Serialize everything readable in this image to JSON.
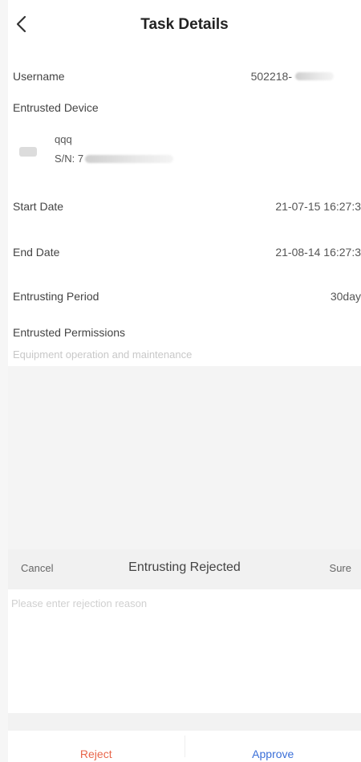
{
  "header": {
    "title": "Task Details",
    "back_icon": "chevron-left-icon"
  },
  "details": {
    "username_label": "Username",
    "username_value": "502218-",
    "device_label": "Entrusted Device",
    "device_icon": "device-icon",
    "device_name": "qqq",
    "device_sn": "S/N: 7",
    "start_label": "Start Date",
    "start_value": "21-07-15 16:27:3",
    "end_label": "End Date",
    "end_value": "21-08-14 16:27:3",
    "period_label": "Entrusting Period",
    "period_value": "30day",
    "permissions_label": "Entrusted Permissions",
    "permissions_value": "Equipment operation and maintenance"
  },
  "reject_sheet": {
    "cancel_label": "Cancel",
    "title": "Entrusting Rejected",
    "sure_label": "Sure",
    "reason_placeholder": "Please enter rejection reason"
  },
  "footer": {
    "reject_label": "Reject",
    "reject_color": "#e8664a",
    "approve_label": "Approve",
    "approve_color": "#3a6fd8"
  }
}
